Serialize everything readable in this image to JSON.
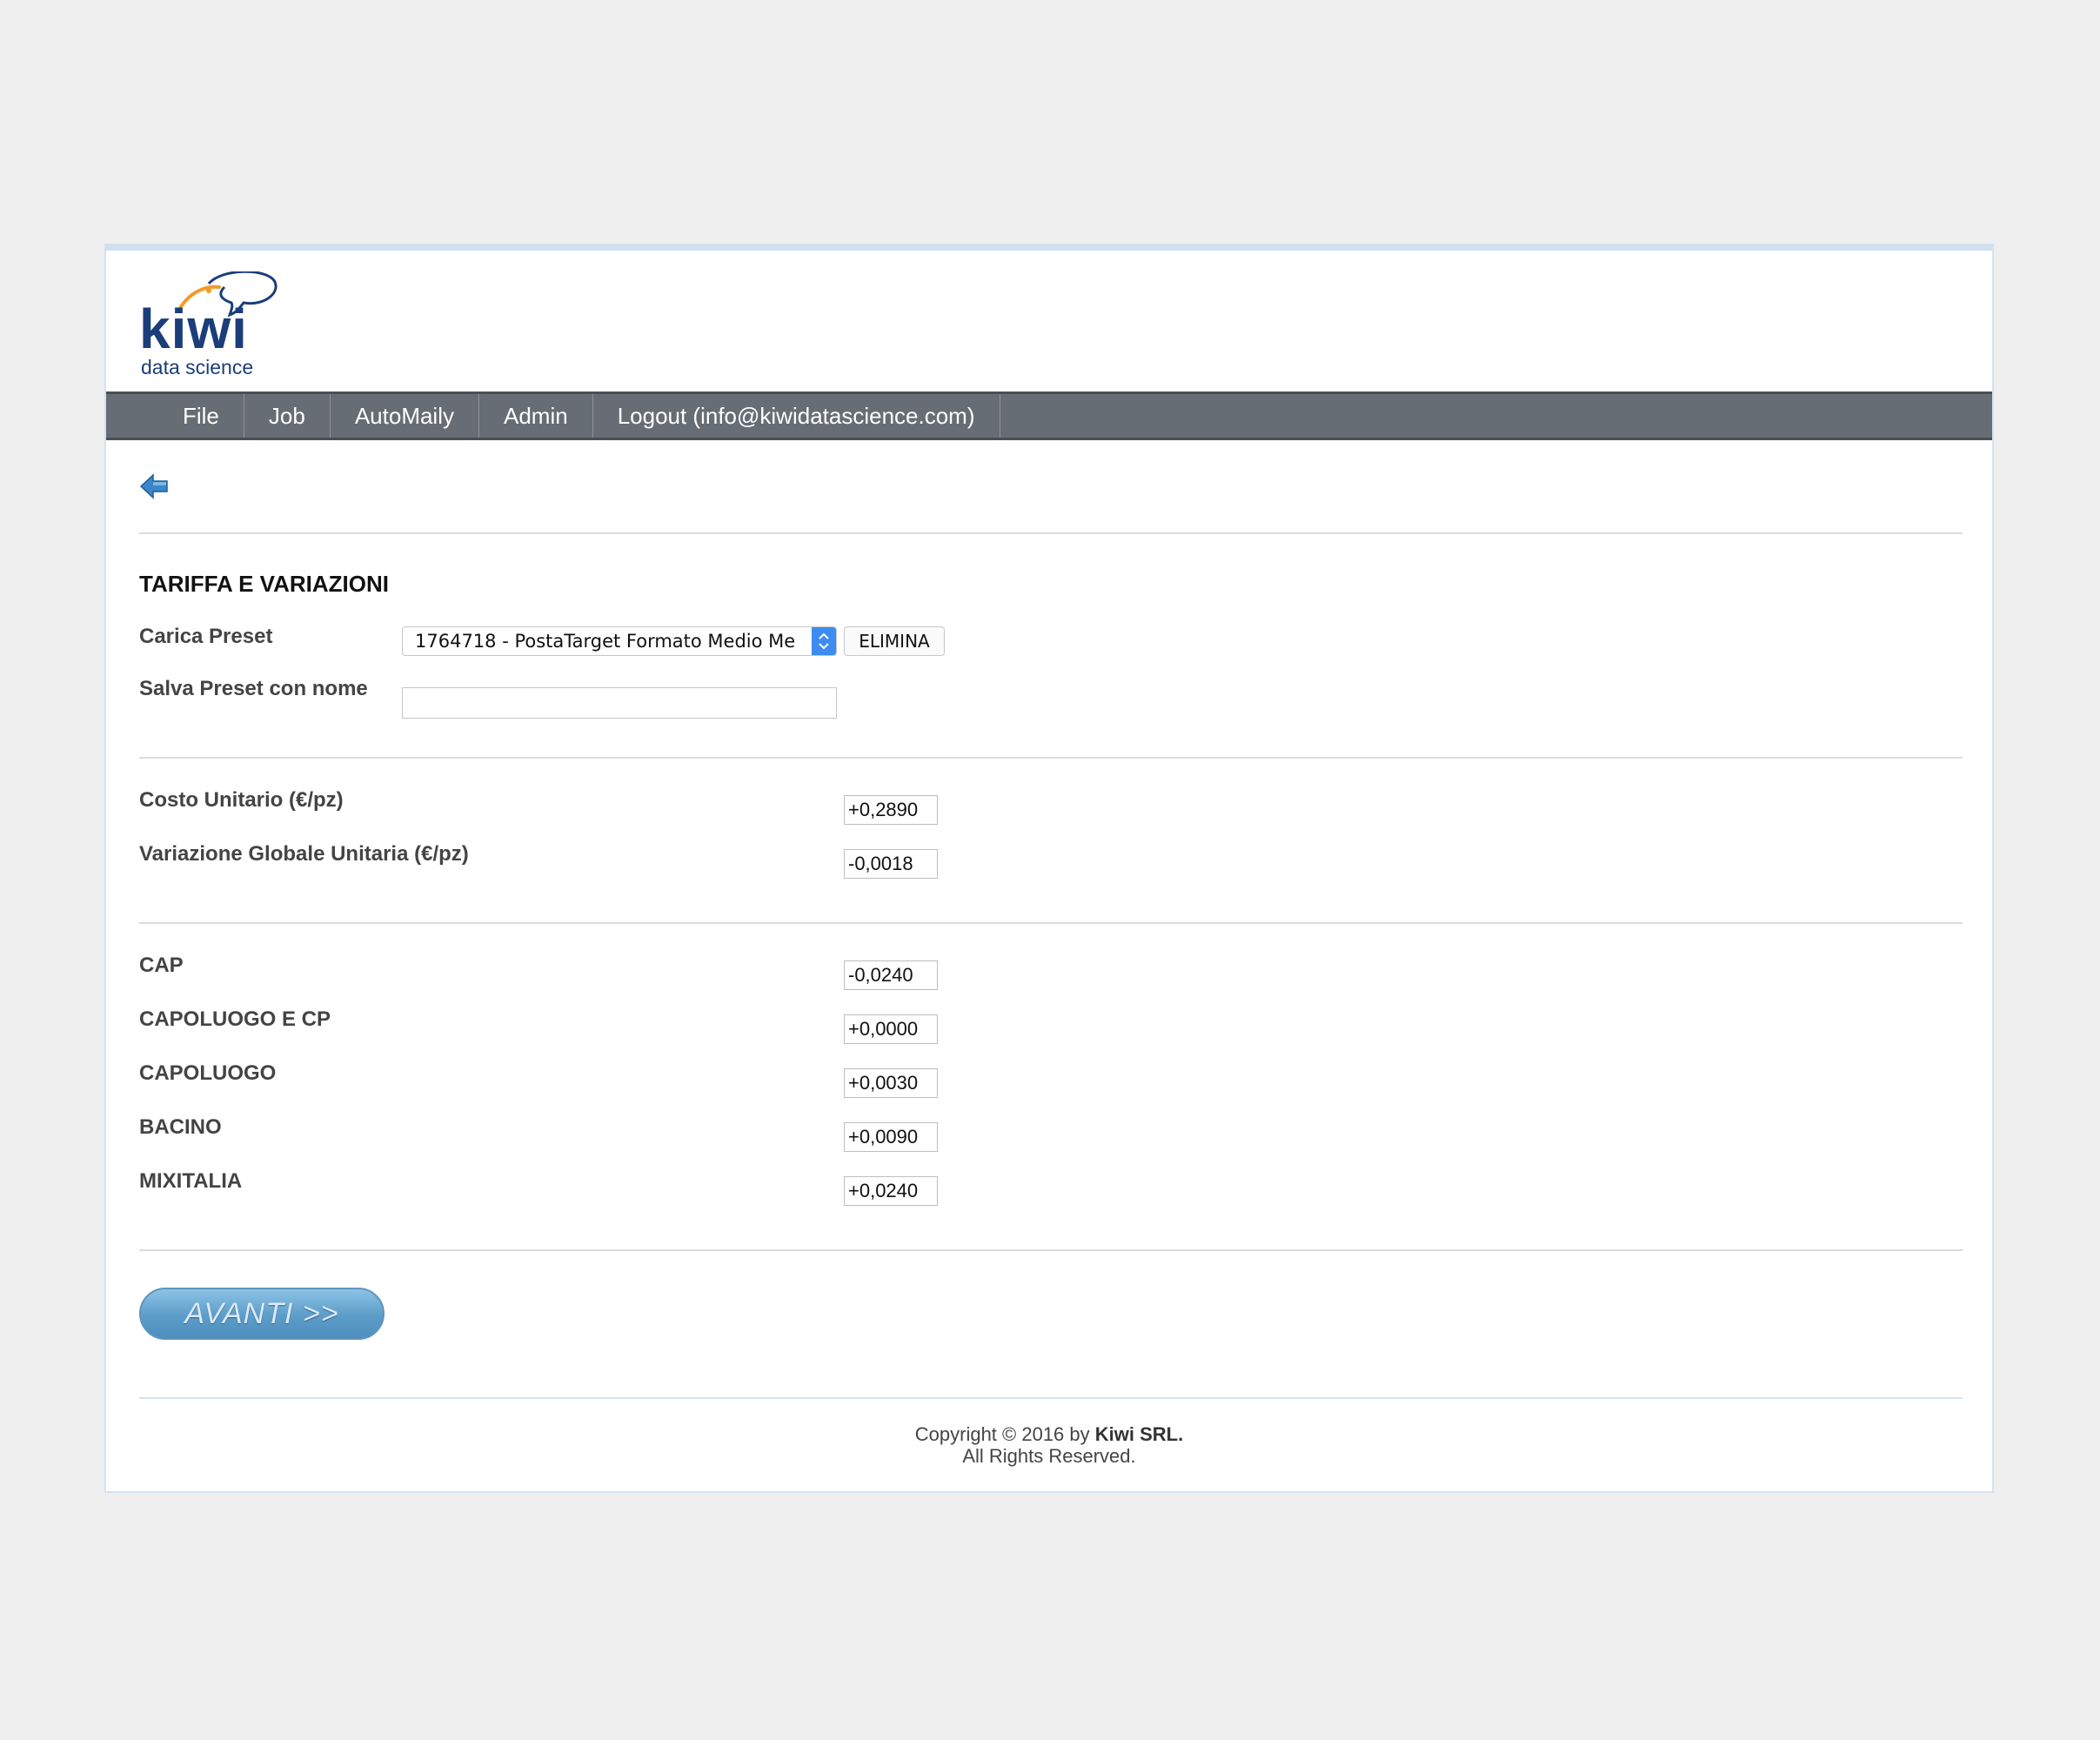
{
  "logo": {
    "word": "kiwi",
    "sub": "data science"
  },
  "nav": {
    "items": [
      "File",
      "Job",
      "AutoMaily",
      "Admin",
      "Logout (info@kiwidatascience.com)"
    ]
  },
  "section_title": "TARIFFA E VARIAZIONI",
  "preset": {
    "load_label": "Carica Preset",
    "selected": "1764718 - PostaTarget Formato Medio Me",
    "delete_label": "ELIMINA",
    "save_label": "Salva Preset con nome",
    "save_value": ""
  },
  "costs": {
    "unit_cost_label": "Costo Unitario (€/pz)",
    "unit_cost_value": "+0,2890",
    "global_var_label": "Variazione Globale Unitaria (€/pz)",
    "global_var_value": "-0,0018"
  },
  "variations": [
    {
      "label": "CAP",
      "value": "-0,0240"
    },
    {
      "label": "CAPOLUOGO E CP",
      "value": "+0,0000"
    },
    {
      "label": "CAPOLUOGO",
      "value": "+0,0030"
    },
    {
      "label": "BACINO",
      "value": "+0,0090"
    },
    {
      "label": "MIXITALIA",
      "value": "+0,0240"
    }
  ],
  "avanti_label": "AVANTI >>",
  "footer": {
    "copyright_prefix": "Copyright © 2016 by",
    "company": "Kiwi SRL.",
    "rights": "All Rights Reserved."
  },
  "colors": {
    "navbar": "#676d74",
    "logo_blue": "#1b3e7a",
    "logo_orange": "#f19a2a",
    "button_blue": "#5c9cc9"
  }
}
